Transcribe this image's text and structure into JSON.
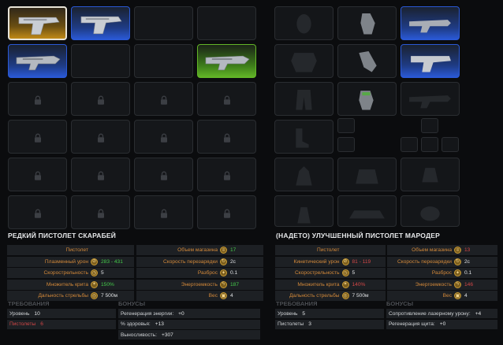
{
  "left": {
    "title": "РЕДКИЙ ПИСТОЛЕТ СКАРАБЕЙ",
    "stats": [
      {
        "name_l": "Пистолет",
        "val_l": "",
        "icon_l": "",
        "col_l": "",
        "name_r": "Объем магазина",
        "val_r": "17",
        "icon_r": "magazine",
        "col_r": "green"
      },
      {
        "name_l": "Плазменный урон",
        "val_l": "283 - 431",
        "icon_l": "plasma",
        "col_l": "green",
        "name_r": "Скорость перезарядки",
        "val_r": "2с",
        "icon_r": "reload",
        "col_r": ""
      },
      {
        "name_l": "Скорострельность",
        "val_l": "5",
        "icon_l": "rate",
        "col_l": "",
        "name_r": "Разброс",
        "val_r": "0.1",
        "icon_r": "spread",
        "col_r": ""
      },
      {
        "name_l": "Множитель крита",
        "val_l": "150%",
        "icon_l": "crit",
        "col_l": "green",
        "name_r": "Энергоемкость",
        "val_r": "187",
        "icon_r": "energy",
        "col_r": "green"
      },
      {
        "name_l": "Дальность стрельбы",
        "val_l": "7 500м",
        "icon_l": "range",
        "col_l": "",
        "name_r": "Вес",
        "val_r": "4",
        "icon_r": "weight",
        "col_r": ""
      }
    ],
    "req_heading": "ТРЕБОВАНИЯ",
    "bonus_heading": "БОНУСЫ",
    "requirements": [
      {
        "k": "Уровень",
        "v": "10",
        "red": false
      },
      {
        "k": "Пистолеты",
        "v": "6",
        "red": true
      }
    ],
    "bonuses": [
      {
        "k": "Регенерация энергии:",
        "v": "+0"
      },
      {
        "k": "% здоровья:",
        "v": "+13"
      },
      {
        "k": "Выносливость:",
        "v": "+307"
      }
    ]
  },
  "right": {
    "title": "(НАДЕТО) УЛУЧШЕННЫЙ ПИСТОЛЕТ МАРОДЕР",
    "stats": [
      {
        "name_l": "Пистолет",
        "val_l": "",
        "icon_l": "",
        "col_l": "",
        "name_r": "Объем магазина",
        "val_r": "13",
        "icon_r": "magazine",
        "col_r": "red"
      },
      {
        "name_l": "Кинетический урон",
        "val_l": "81 - 119",
        "icon_l": "kinetic",
        "col_l": "red",
        "name_r": "Скорость перезарядки",
        "val_r": "2с",
        "icon_r": "reload",
        "col_r": ""
      },
      {
        "name_l": "Скорострельность",
        "val_l": "5",
        "icon_l": "rate",
        "col_l": "",
        "name_r": "Разброс",
        "val_r": "0.1",
        "icon_r": "spread",
        "col_r": ""
      },
      {
        "name_l": "Множитель крита",
        "val_l": "140%",
        "icon_l": "crit",
        "col_l": "red",
        "name_r": "Энергоемкость",
        "val_r": "146",
        "icon_r": "energy",
        "col_r": "red"
      },
      {
        "name_l": "Дальность стрельбы",
        "val_l": "7 500м",
        "icon_l": "range",
        "col_l": "",
        "name_r": "Вес",
        "val_r": "4",
        "icon_r": "weight",
        "col_r": ""
      }
    ],
    "req_heading": "ТРЕБОВАНИЯ",
    "bonus_heading": "БОНУСЫ",
    "requirements": [
      {
        "k": "Уровень",
        "v": "5",
        "red": false
      },
      {
        "k": "Пистолеты",
        "v": "3",
        "red": false
      }
    ],
    "bonuses": [
      {
        "k": "Сопротивление лазерному урону:",
        "v": "+4"
      },
      {
        "k": "Регенерация щита:",
        "v": "+0"
      }
    ]
  },
  "inventory": {
    "slots": [
      {
        "state": "item",
        "rarity": "orange",
        "selected": true,
        "icon": "pistol-icon"
      },
      {
        "state": "item",
        "rarity": "blue",
        "selected": false,
        "icon": "pistol-icon"
      },
      {
        "state": "empty"
      },
      {
        "state": "empty"
      },
      {
        "state": "item",
        "rarity": "blue",
        "selected": false,
        "icon": "rifle-icon"
      },
      {
        "state": "empty"
      },
      {
        "state": "empty"
      },
      {
        "state": "item",
        "rarity": "green",
        "selected": false,
        "icon": "rifle-icon"
      },
      {
        "state": "locked"
      },
      {
        "state": "locked"
      },
      {
        "state": "locked"
      },
      {
        "state": "locked"
      },
      {
        "state": "locked"
      },
      {
        "state": "locked"
      },
      {
        "state": "locked"
      },
      {
        "state": "locked"
      },
      {
        "state": "locked"
      },
      {
        "state": "locked"
      },
      {
        "state": "locked"
      },
      {
        "state": "locked"
      },
      {
        "state": "locked"
      },
      {
        "state": "locked"
      },
      {
        "state": "locked"
      },
      {
        "state": "locked"
      }
    ]
  },
  "colors": {
    "orange": "#c08a16",
    "blue": "#2a59d6",
    "green": "#62b527",
    "stat_name": "#d3893a",
    "good": "#44c94a",
    "bad": "#d24747"
  }
}
